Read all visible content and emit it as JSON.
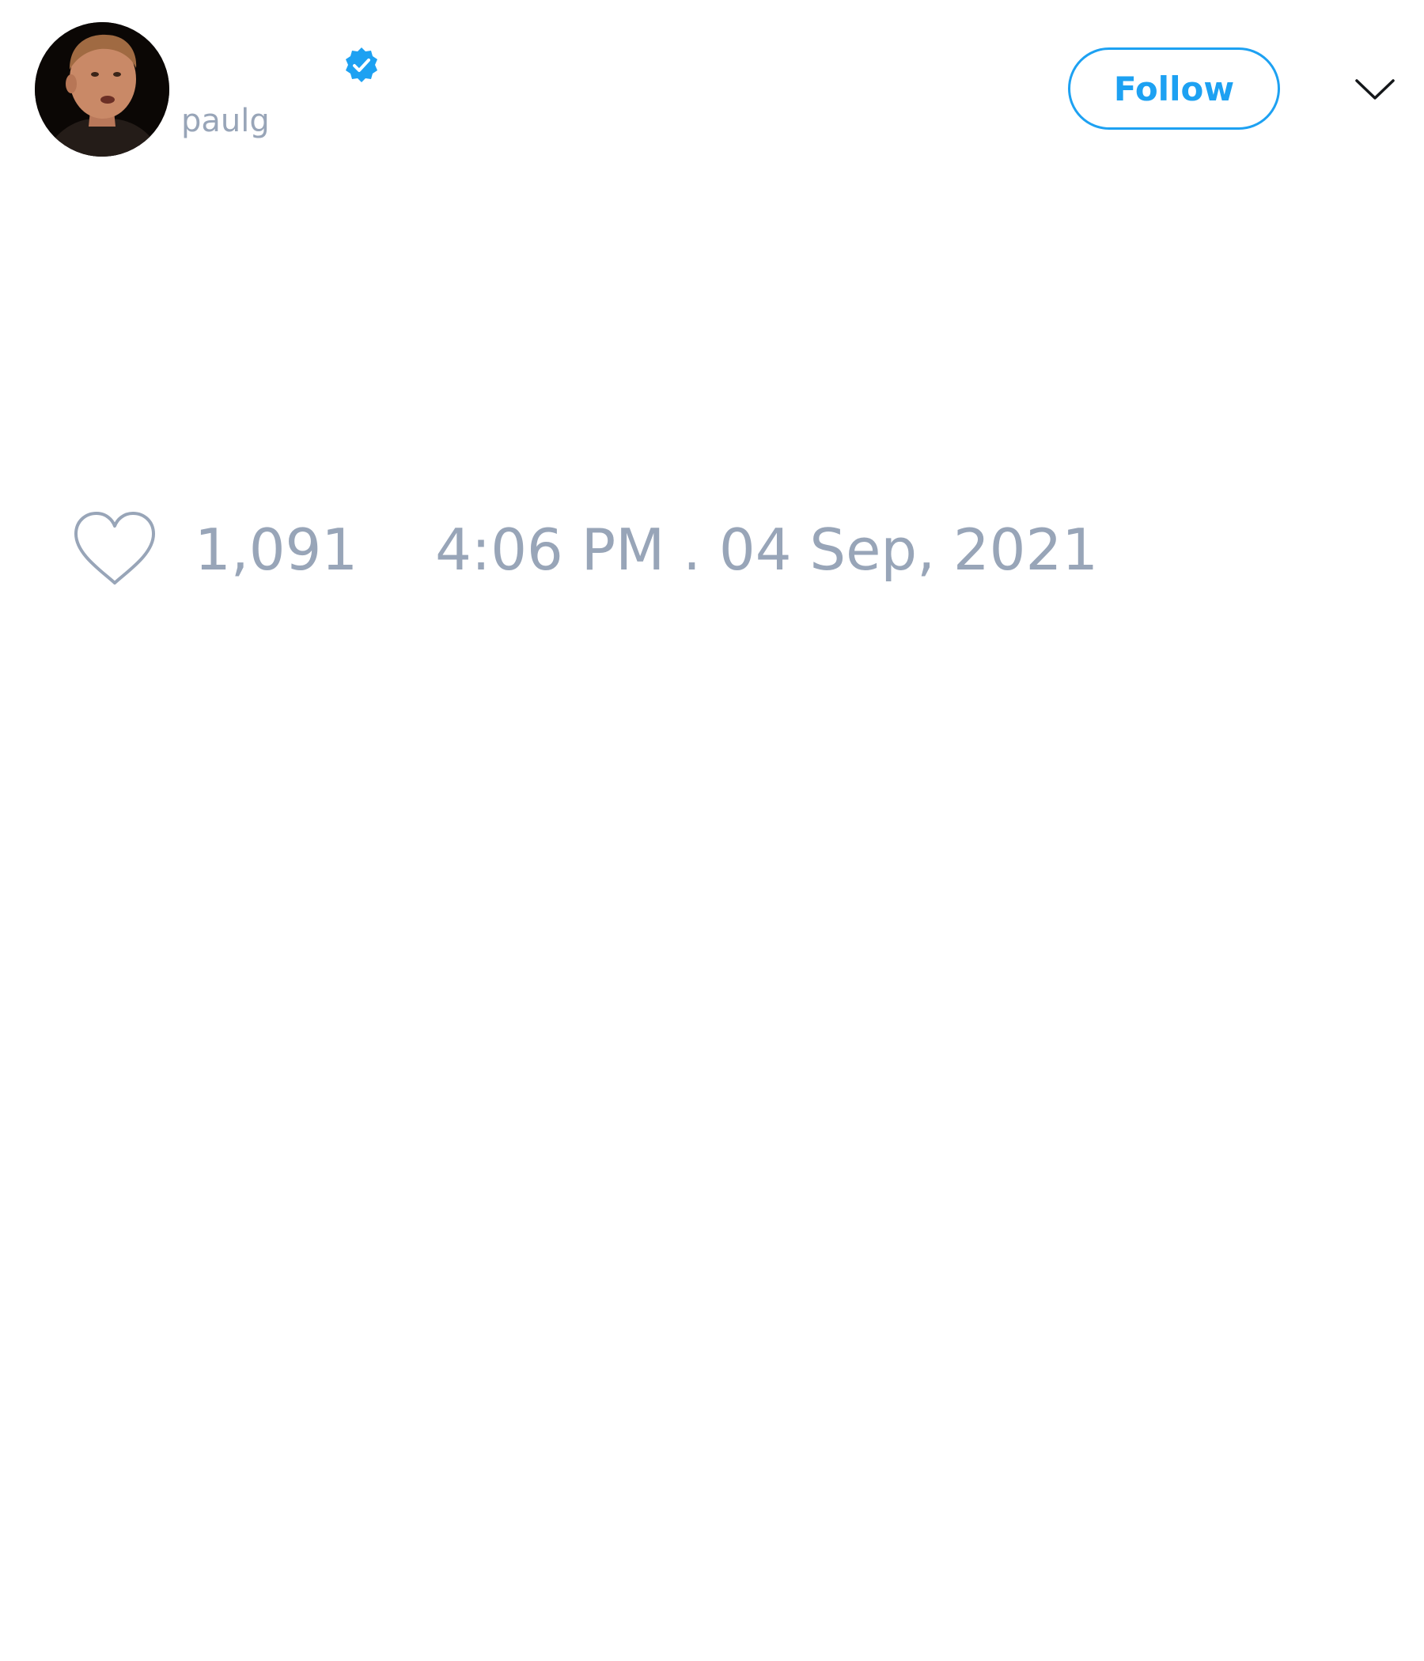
{
  "tweet": {
    "author": {
      "display_name": "",
      "username": "paulg",
      "verified": true,
      "avatar_icon": "avatar-photo"
    },
    "follow_label": "Follow",
    "more_icon": "chevron-down-icon",
    "text": "",
    "likes": "1,091",
    "timestamp": "4:06 PM . 04 Sep, 2021"
  },
  "colors": {
    "accent": "#1da1f2",
    "muted_text": "#98a5b8",
    "background": "#ffffff"
  }
}
